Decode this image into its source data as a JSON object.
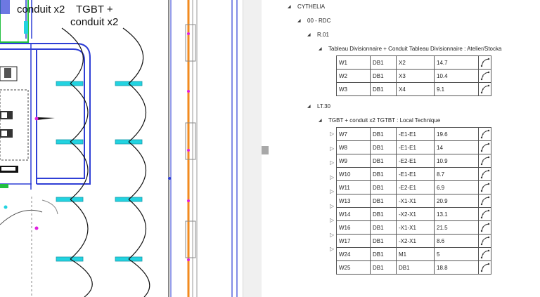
{
  "drawing": {
    "labels": {
      "a": "conduit x2",
      "b": "TGBT +",
      "c": "conduit x2"
    }
  },
  "tree": {
    "root": "CYTHELIA",
    "level": "00 - RDC",
    "room1": "R.01",
    "room1_child": "Tableau Divisionnaire + Conduit   Tableau Divisionnaire : Atelier/Stocka",
    "room2": "LT.30",
    "room2_child": "TGBT + conduit x2   TGTBT : Local Technique"
  },
  "table1": [
    [
      "W1",
      "DB1",
      "X2",
      "14.7"
    ],
    [
      "W2",
      "DB1",
      "X3",
      "10.4"
    ],
    [
      "W3",
      "DB1",
      "X4",
      "9.1"
    ]
  ],
  "table2": [
    [
      "W7",
      "DB1",
      "-E1-E1",
      "19.6"
    ],
    [
      "W8",
      "DB1",
      "-E1-E1",
      "14"
    ],
    [
      "W9",
      "DB1",
      "-E2-E1",
      "10.9"
    ],
    [
      "W10",
      "DB1",
      "-E1-E1",
      "8.7"
    ],
    [
      "W11",
      "DB1",
      "-E2-E1",
      "6.9"
    ],
    [
      "W13",
      "DB1",
      "-X1-X1",
      "20.9"
    ],
    [
      "W14",
      "DB1",
      "-X2-X1",
      "13.1"
    ],
    [
      "W16",
      "DB1",
      "-X1-X1",
      "21.5"
    ],
    [
      "W17",
      "DB1",
      "-X2-X1",
      "8.6"
    ],
    [
      "W24",
      "DB1",
      "M1",
      "5"
    ],
    [
      "W25",
      "DB1",
      "DB1",
      "18.8"
    ]
  ],
  "colors": {
    "wall": "#2f3fd6",
    "conduit": "#f28a1e",
    "fixture": "#22d3e0",
    "marker": "#e020e0",
    "green": "#22c040"
  }
}
